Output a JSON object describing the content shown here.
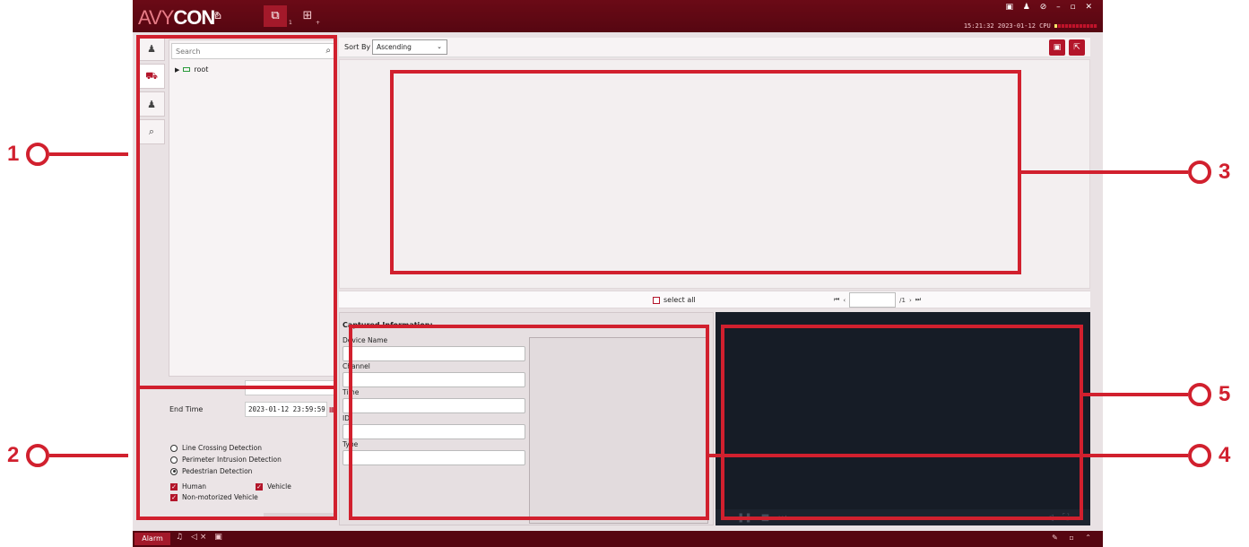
{
  "titlebar": {
    "logo_prefix": "AVY",
    "logo_main": "CON",
    "logo_mark": "®",
    "tabs": [
      {
        "icon": "home-icon",
        "glyph": "⌂"
      },
      {
        "icon": "image-search-icon",
        "glyph": "⧉",
        "sub": "1",
        "active": true
      },
      {
        "icon": "grid-view-icon",
        "glyph": "⊞",
        "sub": "+"
      }
    ],
    "window_controls": "▣ ♟ ⊘ – ▫ ✕",
    "clock": "15:21:32 2023-01-12 CPU"
  },
  "sidebar": {
    "tabs": [
      {
        "icon": "face-icon",
        "glyph": "♟"
      },
      {
        "icon": "vehicle-icon",
        "glyph": "⛟",
        "active": true
      },
      {
        "icon": "person-icon",
        "glyph": "♟"
      },
      {
        "icon": "plate-search-icon",
        "glyph": "⌕"
      }
    ]
  },
  "tree": {
    "search_placeholder": "Search",
    "root_label": "root"
  },
  "filter": {
    "end_time_label": "End Time",
    "end_time_value": "2023-01-12 23:59:59",
    "detections": [
      {
        "label": "Line Crossing Detection",
        "selected": false
      },
      {
        "label": "Perimeter Intrusion Detection",
        "selected": false
      },
      {
        "label": "Pedestrian Detection",
        "selected": true
      }
    ],
    "targets": [
      {
        "label": "Human",
        "checked": true
      },
      {
        "label": "Vehicle",
        "checked": true
      },
      {
        "label": "Non-motorized Vehicle",
        "checked": true
      }
    ]
  },
  "toolbar": {
    "sort_label": "Sort By",
    "sort_value": "Ascending"
  },
  "pager": {
    "select_all": "select all",
    "page_total": "/1"
  },
  "captured": {
    "title": "Captured Information:",
    "fields": [
      {
        "label": "Device Name",
        "value": ""
      },
      {
        "label": "Channel",
        "value": ""
      },
      {
        "label": "Time",
        "value": ""
      },
      {
        "label": "ID",
        "value": ""
      },
      {
        "label": "Type",
        "value": ""
      }
    ]
  },
  "statusbar": {
    "alarm_label": "Alarm"
  },
  "callouts": [
    "1",
    "2",
    "3",
    "4",
    "5"
  ],
  "colors": {
    "accent": "#b3152a",
    "titlebar": "#560611",
    "annotation": "#d1202e",
    "video_bg": "#161c26"
  }
}
